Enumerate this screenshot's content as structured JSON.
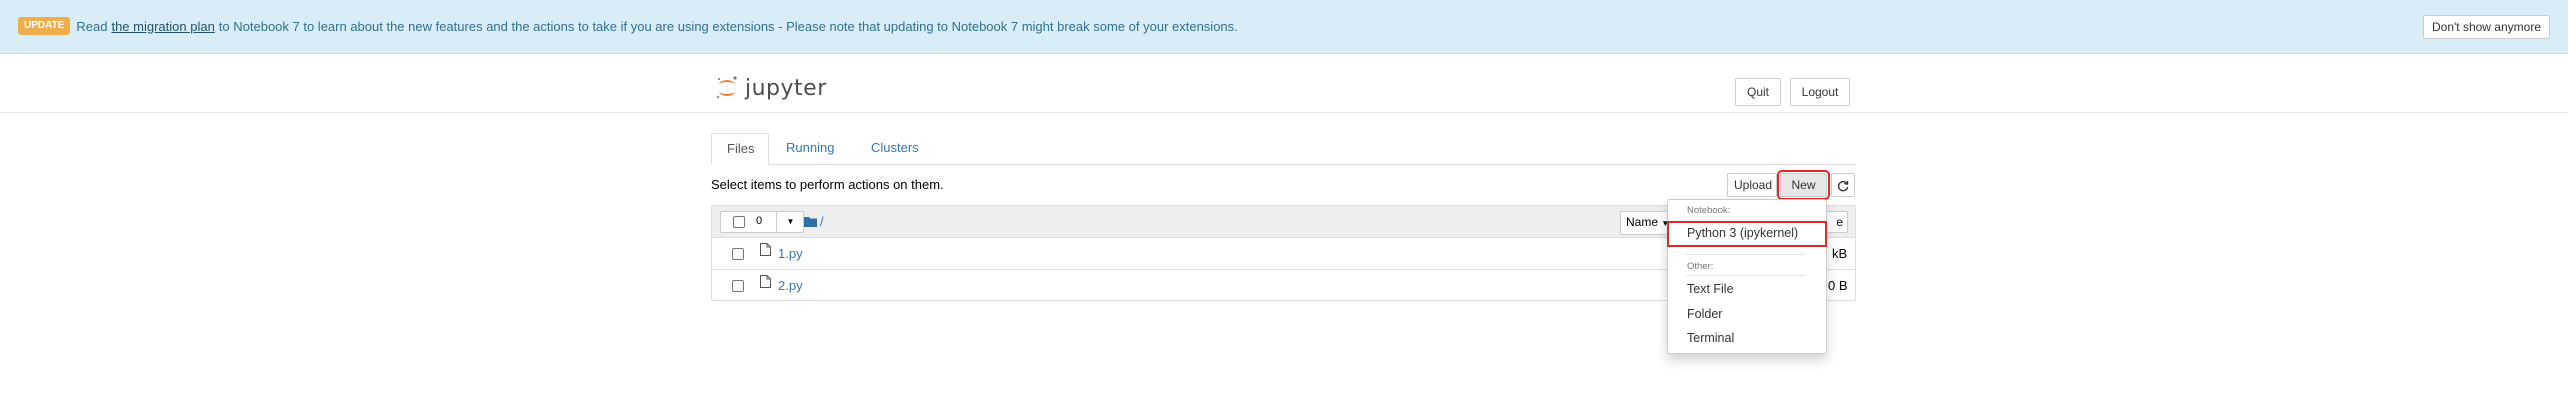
{
  "banner": {
    "badge": "UPDATE",
    "text_before": "Read",
    "link": "the migration plan",
    "text_after": "to Notebook 7 to learn about the new features and the actions to take if you are using extensions - Please note that updating to Notebook 7 might break some of your extensions.",
    "dismiss_label": "Don't show anymore"
  },
  "header": {
    "logo_text": "jupyter",
    "quit_label": "Quit",
    "logout_label": "Logout"
  },
  "tabs": [
    {
      "label": "Files",
      "active": true
    },
    {
      "label": "Running",
      "active": false
    },
    {
      "label": "Clusters",
      "active": false
    }
  ],
  "toolbar": {
    "instructions": "Select items to perform actions on them.",
    "upload_label": "Upload",
    "new_label": "New",
    "refresh_icon": "refresh-icon"
  },
  "file_list": {
    "selected_count": "0",
    "breadcrumb": "/",
    "sort_label": "Name",
    "files": [
      {
        "name": "1.py",
        "size": "kB"
      },
      {
        "name": "2.py",
        "size": "0 B"
      }
    ]
  },
  "new_menu": {
    "notebook_header": "Notebook:",
    "kernel_item": "Python 3 (ipykernel)",
    "other_header": "Other:",
    "items": [
      "Text File",
      "Folder",
      "Terminal"
    ]
  },
  "colors": {
    "link": "#337ab7",
    "banner_bg": "#d9edf7",
    "highlight": "#e02626",
    "jupyter_orange": "#f37726"
  }
}
